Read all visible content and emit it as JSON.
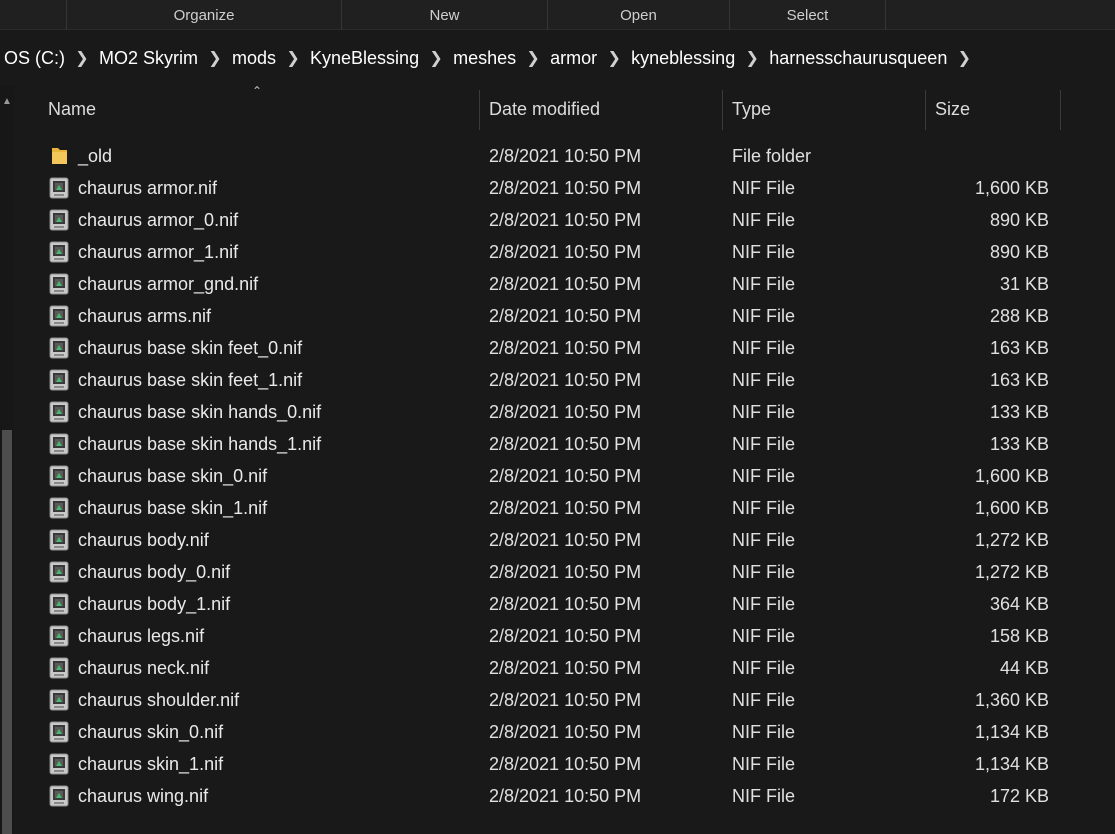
{
  "ribbon": {
    "groups": [
      "Organize",
      "New",
      "Open",
      "Select"
    ]
  },
  "breadcrumb": [
    "OS (C:)",
    "MO2 Skyrim",
    "mods",
    "KyneBlessing",
    "meshes",
    "armor",
    "kyneblessing",
    "harnesschaurusqueen"
  ],
  "columns": {
    "name": "Name",
    "date": "Date modified",
    "type": "Type",
    "size": "Size"
  },
  "files": [
    {
      "name": "_old",
      "date": "2/8/2021 10:50 PM",
      "type": "File folder",
      "size": "",
      "icon": "folder-icon"
    },
    {
      "name": "chaurus armor.nif",
      "date": "2/8/2021 10:50 PM",
      "type": "NIF File",
      "size": "1,600 KB",
      "icon": "nif-file-icon"
    },
    {
      "name": "chaurus armor_0.nif",
      "date": "2/8/2021 10:50 PM",
      "type": "NIF File",
      "size": "890 KB",
      "icon": "nif-file-icon"
    },
    {
      "name": "chaurus armor_1.nif",
      "date": "2/8/2021 10:50 PM",
      "type": "NIF File",
      "size": "890 KB",
      "icon": "nif-file-icon"
    },
    {
      "name": "chaurus armor_gnd.nif",
      "date": "2/8/2021 10:50 PM",
      "type": "NIF File",
      "size": "31 KB",
      "icon": "nif-file-icon"
    },
    {
      "name": "chaurus arms.nif",
      "date": "2/8/2021 10:50 PM",
      "type": "NIF File",
      "size": "288 KB",
      "icon": "nif-file-icon"
    },
    {
      "name": "chaurus base skin feet_0.nif",
      "date": "2/8/2021 10:50 PM",
      "type": "NIF File",
      "size": "163 KB",
      "icon": "nif-file-icon"
    },
    {
      "name": "chaurus base skin feet_1.nif",
      "date": "2/8/2021 10:50 PM",
      "type": "NIF File",
      "size": "163 KB",
      "icon": "nif-file-icon"
    },
    {
      "name": "chaurus base skin hands_0.nif",
      "date": "2/8/2021 10:50 PM",
      "type": "NIF File",
      "size": "133 KB",
      "icon": "nif-file-icon"
    },
    {
      "name": "chaurus base skin hands_1.nif",
      "date": "2/8/2021 10:50 PM",
      "type": "NIF File",
      "size": "133 KB",
      "icon": "nif-file-icon"
    },
    {
      "name": "chaurus base skin_0.nif",
      "date": "2/8/2021 10:50 PM",
      "type": "NIF File",
      "size": "1,600 KB",
      "icon": "nif-file-icon"
    },
    {
      "name": "chaurus base skin_1.nif",
      "date": "2/8/2021 10:50 PM",
      "type": "NIF File",
      "size": "1,600 KB",
      "icon": "nif-file-icon"
    },
    {
      "name": "chaurus body.nif",
      "date": "2/8/2021 10:50 PM",
      "type": "NIF File",
      "size": "1,272 KB",
      "icon": "nif-file-icon"
    },
    {
      "name": "chaurus body_0.nif",
      "date": "2/8/2021 10:50 PM",
      "type": "NIF File",
      "size": "1,272 KB",
      "icon": "nif-file-icon"
    },
    {
      "name": "chaurus body_1.nif",
      "date": "2/8/2021 10:50 PM",
      "type": "NIF File",
      "size": "364 KB",
      "icon": "nif-file-icon"
    },
    {
      "name": "chaurus legs.nif",
      "date": "2/8/2021 10:50 PM",
      "type": "NIF File",
      "size": "158 KB",
      "icon": "nif-file-icon"
    },
    {
      "name": "chaurus neck.nif",
      "date": "2/8/2021 10:50 PM",
      "type": "NIF File",
      "size": "44 KB",
      "icon": "nif-file-icon"
    },
    {
      "name": "chaurus shoulder.nif",
      "date": "2/8/2021 10:50 PM",
      "type": "NIF File",
      "size": "1,360 KB",
      "icon": "nif-file-icon"
    },
    {
      "name": "chaurus skin_0.nif",
      "date": "2/8/2021 10:50 PM",
      "type": "NIF File",
      "size": "1,134 KB",
      "icon": "nif-file-icon"
    },
    {
      "name": "chaurus skin_1.nif",
      "date": "2/8/2021 10:50 PM",
      "type": "NIF File",
      "size": "1,134 KB",
      "icon": "nif-file-icon"
    },
    {
      "name": "chaurus wing.nif",
      "date": "2/8/2021 10:50 PM",
      "type": "NIF File",
      "size": "172 KB",
      "icon": "nif-file-icon"
    }
  ],
  "colors": {
    "background": "#191919",
    "text": "#e9e9e9",
    "folder": "#e8b43a"
  }
}
